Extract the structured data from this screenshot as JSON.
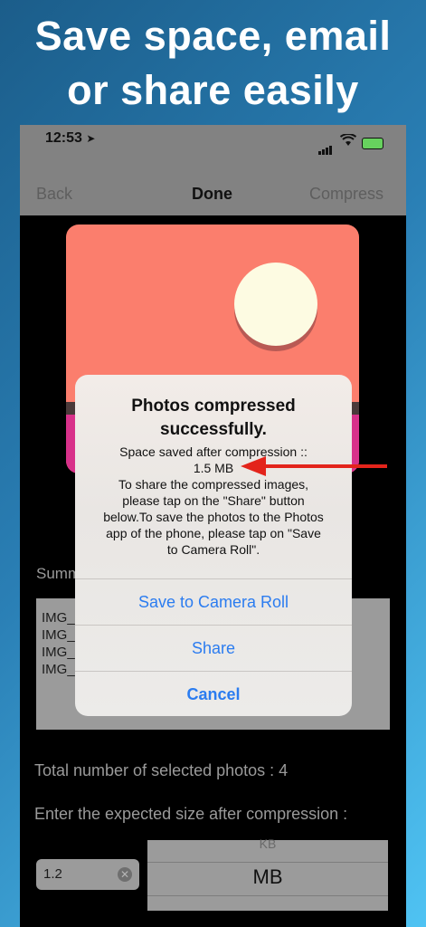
{
  "headline": {
    "line1": "Save space, email",
    "line2": "or share easily"
  },
  "status": {
    "time": "12:53",
    "location_icon": "navigation-arrow-icon"
  },
  "nav": {
    "back": "Back",
    "done": "Done",
    "compress": "Compress"
  },
  "main": {
    "summary_label": "Summ",
    "summary_lines": [
      "IMG_",
      "IMG_",
      "IMG_",
      "IMG_"
    ],
    "total_text": "Total number of selected photos : 4",
    "expected_text": "Enter the expected size after compression :",
    "size_value": "1.2",
    "unit_above": "KB",
    "unit_selected": "MB"
  },
  "alert": {
    "title_line1": "Photos compressed",
    "title_line2": "successfully.",
    "msg_line1": "Space saved after compression ::",
    "msg_line2": "1.5 MB",
    "msg_line3": "To share the compressed images,",
    "msg_line4": "please tap on the \"Share\" button",
    "msg_line5": "below.To save the photos to the Photos",
    "msg_line6": "app of the phone, please tap on \"Save",
    "msg_line7": "to Camera Roll\".",
    "btn_save": "Save to Camera Roll",
    "btn_share": "Share",
    "btn_cancel": "Cancel"
  },
  "colors": {
    "accent": "#2b7cf0",
    "arrow": "#e3241b"
  }
}
